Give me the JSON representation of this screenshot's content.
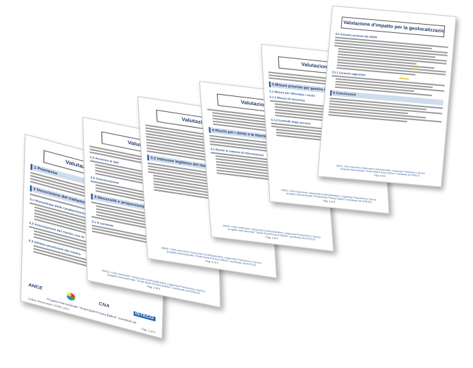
{
  "document": {
    "page_title": "Valutazione d'impatto per la geolocalizzazione",
    "footer_org_line": "ANCE, CNA costruzioni, Assocosat Confcooperative, Legacoop Produzione e Servizi",
    "footer_project_line": "progetto internazionale \"Smart Build Privacy Edition\" coordinato da ISTECO",
    "page_label": "Pag. 1 di 6"
  },
  "pages": [
    {
      "title": "Valutazione d'impatto",
      "sections": [
        "1 Premessa",
        "2 Descrizione del trattamento",
        "2.1 Riscontrata delle caratteristiche",
        "2.2 Associazione del rischio con le",
        "2.3 Utilizzo previsione dei contro"
      ],
      "logos": [
        "ANCE",
        "CNA",
        "ISTECO"
      ],
      "project_line": "Progetto internazionale \"Smart Build Privacy Edition\" coordinato da",
      "code": "Codice Documento: STMO_001+",
      "page": "Pag. 1 di 6"
    },
    {
      "title": "Valutazione d'im",
      "sections": [
        "2.4 Accesso ai dati",
        "2.5 Conservazione",
        "3 Necessità e proporzionalità",
        "3.1 Il contesto"
      ],
      "page": "Pag. 2 di 6"
    },
    {
      "title": "Valutazione d'im",
      "sections": [
        "3.2 Interesse legittimo del titolare"
      ],
      "page": "Pag. 3 di 6"
    },
    {
      "title": "Valutazione d'im",
      "sections": [
        "4 Rischi per i diritti e le libertà",
        "4.1 Rischi in materia di informazione"
      ],
      "page": "Pag. 4 di 6"
    },
    {
      "title": "Valutazione d'im",
      "sections": [
        "5 Misure previste per gestire i rischi",
        "5.1 Misure per affrontare i rischi",
        "5.1.1 Misure di sicurezza",
        "5.1.2 Controlli degli accessi"
      ],
      "page": "Pag. 5 di 6"
    },
    {
      "title": "Valutazione d'impatto per la geolocalizzazione",
      "sections": [
        "5.2 Garanzie previste dal GDPR",
        "5.2.1 Garanzie aggiuntive",
        "6 Conclusioni"
      ],
      "page": "Pag. 6 di 6"
    }
  ],
  "colors": {
    "title_text": "#1f3864",
    "section_fill": "#cfdcec",
    "section_rule": "#2f5597",
    "highlight": "#e8d44a"
  }
}
